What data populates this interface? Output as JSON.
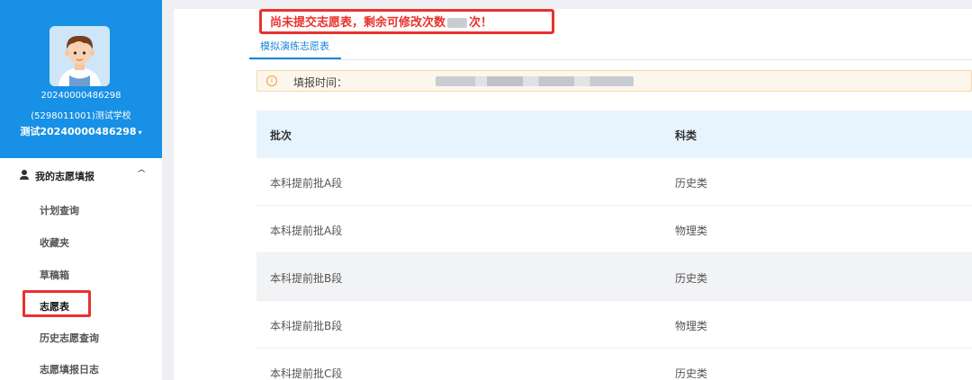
{
  "sidebar": {
    "profile": {
      "user_id": "20240000486298",
      "school": "(5298011001)测试学校",
      "display_name": "测试20240000486298",
      "dropdown_caret": "▾"
    },
    "menu_group": {
      "label": "我的志愿填报",
      "chevron": "^"
    },
    "items": [
      {
        "label": "计划查询"
      },
      {
        "label": "收藏夹"
      },
      {
        "label": "草稿箱"
      },
      {
        "label": "志愿表"
      },
      {
        "label": "历史志愿查询"
      },
      {
        "label": "志愿填报日志"
      }
    ],
    "active_item": "志愿表"
  },
  "main": {
    "notice": {
      "prefix": "尚未提交志愿表，剩余可修改次数",
      "suffix": "次！"
    },
    "tab": {
      "label": "模拟演练志愿表"
    },
    "alert": {
      "icon": "i",
      "label": "填报时间："
    },
    "table": {
      "headers": [
        "批次",
        "科类"
      ],
      "rows": [
        [
          "本科提前批A段",
          "历史类"
        ],
        [
          "本科提前批A段",
          "物理类"
        ],
        [
          "本科提前批B段",
          "历史类"
        ],
        [
          "本科提前批B段",
          "物理类"
        ],
        [
          "本科提前批C段",
          "历史类"
        ]
      ]
    }
  },
  "colors": {
    "profile_bg": "#1790e5",
    "accent": "#1a86d6",
    "highlight": "#e8322d",
    "table_header_bg": "#e8f4fd",
    "alert_bg": "#fdf6ec"
  }
}
